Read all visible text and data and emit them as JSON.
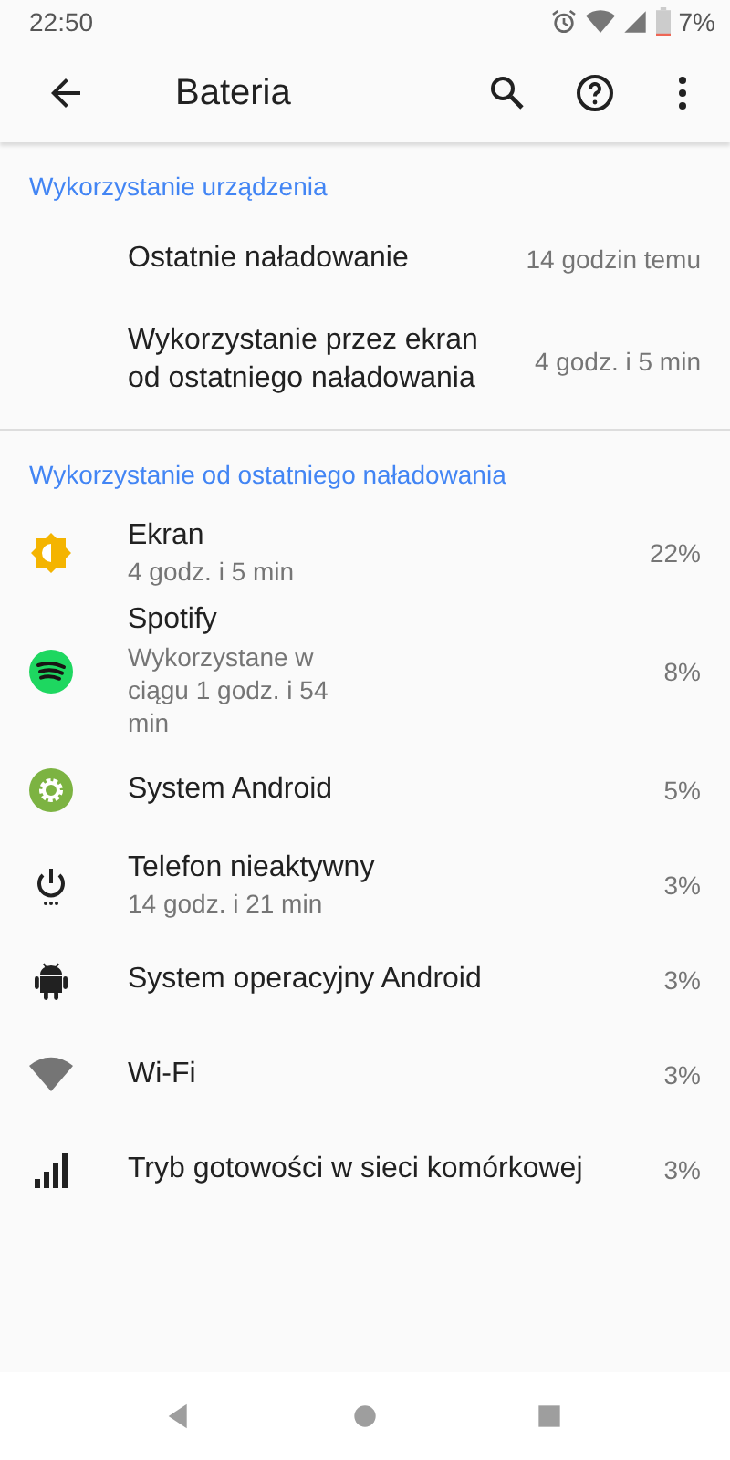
{
  "status_bar": {
    "time": "22:50",
    "battery": "7%"
  },
  "toolbar": {
    "title": "Bateria"
  },
  "sections": [
    {
      "title": "Wykorzystanie urządzenia",
      "items": [
        {
          "title": "Ostatnie naładowanie",
          "value": "14 godzin temu"
        },
        {
          "title": "Wykorzystanie przez ekran od ostatniego naładowania",
          "value": "4 godz. i 5 min"
        }
      ]
    },
    {
      "title": "Wykorzystanie od ostatniego naładowania",
      "items": [
        {
          "kind": "brightness",
          "title": "Ekran",
          "subtitle": "4 godz. i 5 min",
          "value": "22%"
        },
        {
          "kind": "music-app",
          "title": "Spotify",
          "subtitle": "Wykorzystane w ciągu 1 godz. i 54 min",
          "value": "8%"
        },
        {
          "kind": "gear-app",
          "title": "System Android",
          "value": "5%"
        },
        {
          "kind": "power",
          "title": "Telefon nieaktywny",
          "subtitle": "14 godz. i 21 min",
          "value": "3%"
        },
        {
          "kind": "android",
          "title": "System operacyjny Android",
          "value": "3%"
        },
        {
          "kind": "wifi",
          "title": "Wi-Fi",
          "value": "3%"
        },
        {
          "kind": "cell",
          "title": "Tryb gotowości w sieci komórkowej",
          "value": "3%"
        }
      ]
    }
  ]
}
